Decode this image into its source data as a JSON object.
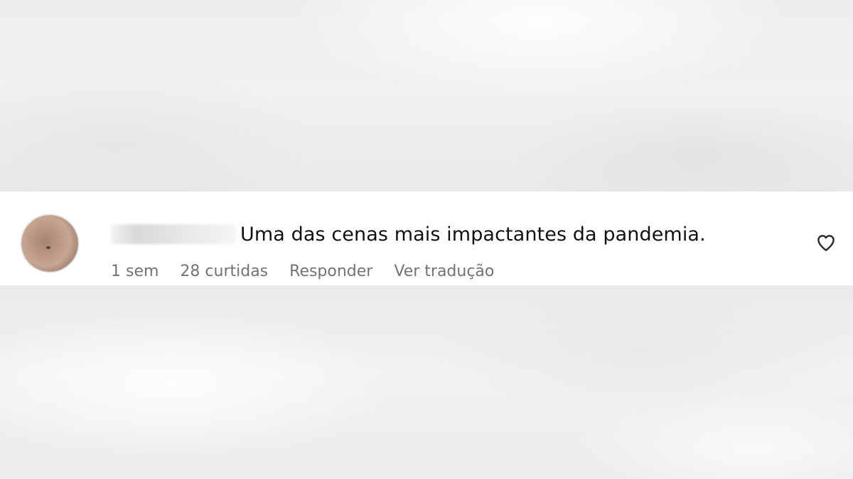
{
  "comment": {
    "text": "Uma das cenas mais impactantes da pandemia.",
    "meta": {
      "time": "1 sem",
      "likes": "28 curtidas",
      "reply_label": "Responder",
      "translate_label": "Ver tradução"
    },
    "like_icon": "heart-outline-icon"
  },
  "colors": {
    "text": "#111111",
    "meta_text": "#737373",
    "strip_background": "#ffffff"
  }
}
